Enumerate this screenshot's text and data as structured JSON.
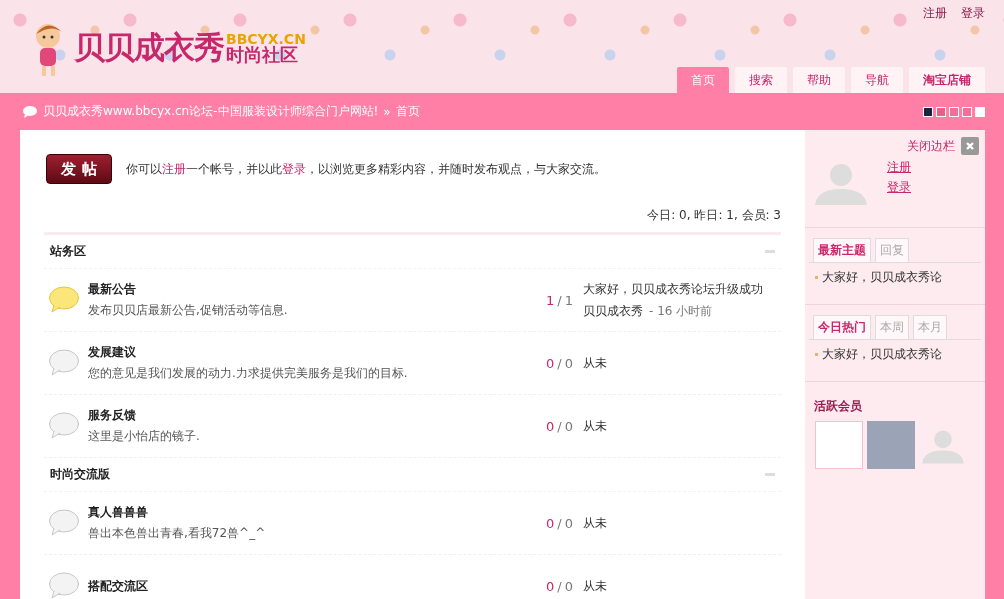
{
  "header": {
    "logo": {
      "name": "贝贝成衣秀",
      "domain": "BBCYX.CN",
      "tagline": "时尚社区"
    },
    "top_links": [
      "注册",
      "登录"
    ],
    "nav": [
      {
        "label": "首页",
        "selected": true
      },
      {
        "label": "搜索",
        "selected": false
      },
      {
        "label": "帮助",
        "selected": false
      },
      {
        "label": "导航",
        "selected": false
      },
      {
        "label": "淘宝店铺",
        "selected": false
      }
    ]
  },
  "breadcrumb": {
    "site": "贝贝成衣秀www.bbcyx.cn论坛-中国服装设计师综合门户网站!",
    "separator": "»",
    "current": "首页"
  },
  "style_swatches": [
    {
      "color": "#1c2340"
    },
    {
      "color": "#e8608a"
    },
    {
      "color": "#f46e96"
    },
    {
      "color": "#f46e96"
    },
    {
      "color": "#ffffff"
    }
  ],
  "post_button": "发 帖",
  "notice": [
    {
      "text": "你可以",
      "link": false
    },
    {
      "text": "注册",
      "link": true
    },
    {
      "text": "一个帐号，并以此",
      "link": false
    },
    {
      "text": "登录",
      "link": true
    },
    {
      "text": "，以浏览更多精彩内容，并随时发布观点，与大家交流。",
      "link": false
    }
  ],
  "stats": "今日: 0, 昨日: 1, 会员: 3",
  "categories": [
    {
      "title": "站务区",
      "forums": [
        {
          "name": "最新公告",
          "description": "发布贝贝店最新公告,促销活动等信息.",
          "new": true,
          "threads": "1",
          "sep": "/",
          "posts": "1",
          "last_title": "大家好，贝贝成衣秀论坛升级成功",
          "last_author": "贝贝成衣秀",
          "last_time": "- 16 小时前"
        },
        {
          "name": "发展建议",
          "description": "您的意见是我们发展的动力.力求提供完美服务是我们的目标.",
          "new": false,
          "threads": "0",
          "sep": "/",
          "posts": "0",
          "last_title": "从未"
        },
        {
          "name": "服务反馈",
          "description": "这里是小怡店的镜子.",
          "new": false,
          "threads": "0",
          "sep": "/",
          "posts": "0",
          "last_title": "从未"
        }
      ]
    },
    {
      "title": "时尚交流版",
      "forums": [
        {
          "name": "真人兽兽兽",
          "description": "兽出本色兽出青春,看我72兽^_^",
          "new": false,
          "threads": "0",
          "sep": "/",
          "posts": "0",
          "last_title": "从未"
        },
        {
          "name": "搭配交流区",
          "new": false,
          "threads": "0",
          "sep": "/",
          "posts": "0",
          "last_title": "从未"
        }
      ]
    }
  ],
  "sidebar": {
    "close_label": "关闭边栏",
    "user_links": [
      "注册",
      "登录"
    ],
    "boxes": [
      {
        "tabs": [
          {
            "label": "最新主题",
            "selected": true
          },
          {
            "label": "回复",
            "selected": false
          }
        ],
        "items": [
          "大家好，贝贝成衣秀论"
        ]
      },
      {
        "tabs": [
          {
            "label": "今日热门",
            "selected": true
          },
          {
            "label": "本周",
            "selected": false
          },
          {
            "label": "本月",
            "selected": false
          }
        ],
        "items": [
          "大家好，贝贝成衣秀论"
        ]
      }
    ],
    "members_title": "活跃会员",
    "members": [
      {
        "kind": "logo"
      },
      {
        "kind": "photo"
      },
      {
        "kind": "default"
      }
    ]
  }
}
